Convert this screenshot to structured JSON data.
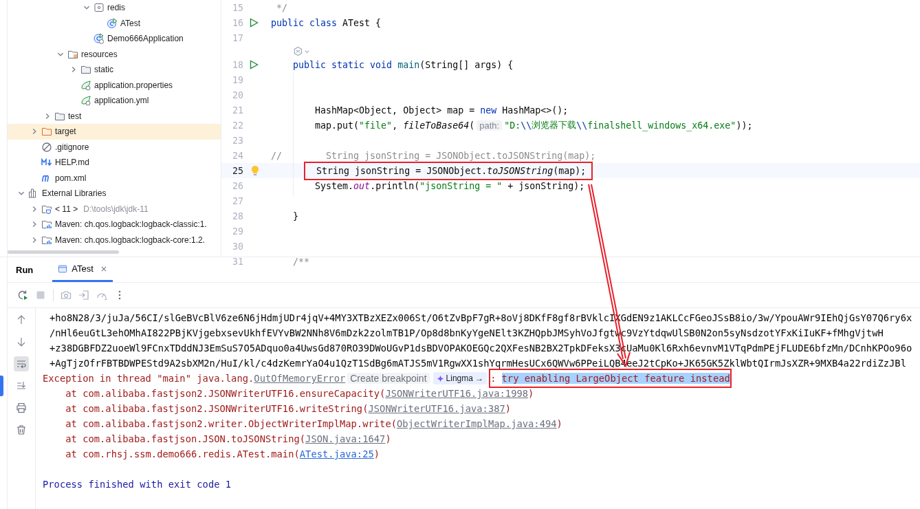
{
  "project_tree": [
    {
      "children": [
        {
          "children": [
            {
              "children": [
                {
                  "children": [
                    {
                      "children": [
                        {
                          "label": "redis",
                          "kind": "package",
                          "expanded": true,
                          "selected": false,
                          "children": [
                            {
                              "label": "ATest",
                              "kind": "class",
                              "selected": false
                            }
                          ]
                        },
                        {
                          "label": "Demo666Application",
                          "kind": "spring-class",
                          "selected": false
                        }
                      ]
                    }
                  ]
                },
                {
                  "label": "resources",
                  "kind": "resources-folder",
                  "expanded": true,
                  "selected": false,
                  "children": [
                    {
                      "label": "static",
                      "kind": "folder",
                      "expanded": false,
                      "selected": false
                    },
                    {
                      "label": "application.properties",
                      "kind": "spring-config",
                      "selected": false
                    },
                    {
                      "label": "application.yml",
                      "kind": "spring-config",
                      "selected": false
                    }
                  ]
                }
              ]
            },
            {
              "label": "test",
              "kind": "folder",
              "expanded": false,
              "selected": false
            }
          ]
        },
        {
          "label": "target",
          "kind": "excluded-folder",
          "expanded": false,
          "selected": true
        },
        {
          "label": ".gitignore",
          "kind": "ignore",
          "selected": false
        },
        {
          "label": "HELP.md",
          "kind": "markdown",
          "selected": false
        },
        {
          "label": "pom.xml",
          "kind": "maven",
          "selected": false
        }
      ]
    },
    {
      "label": "External Libraries",
      "kind": "libraries",
      "expanded": true,
      "selected": false,
      "children": [
        {
          "label": "< 11 >",
          "detail": "D:\\tools\\jdk\\jdk-11",
          "kind": "jdk",
          "expanded": false,
          "selected": false
        },
        {
          "label": "Maven: ch.qos.logback:logback-classic:1.",
          "kind": "library",
          "expanded": false,
          "selected": false
        },
        {
          "label": "Maven: ch.qos.logback:logback-core:1.2.",
          "kind": "library",
          "expanded": false,
          "selected": false
        }
      ]
    }
  ],
  "editor": {
    "lines": [
      {
        "kind": "code",
        "number": "15",
        "current": false,
        "tokens": [
          {
            "text": " */",
            "kind": "comment"
          }
        ]
      },
      {
        "kind": "code",
        "number": "16",
        "current": false,
        "marker": {
          "kind": "run"
        },
        "tokens": [
          {
            "text": "public class ",
            "kind": "keyword"
          },
          {
            "text": "ATest {",
            "kind": "plain"
          }
        ]
      },
      {
        "kind": "code",
        "number": "17",
        "current": false
      },
      {
        "kind": "inlay"
      },
      {
        "kind": "code",
        "number": "18",
        "current": false,
        "marker": {
          "kind": "run"
        },
        "tokens": [
          {
            "text": "    public static void ",
            "kind": "keyword"
          },
          {
            "text": "main",
            "kind": "declaration"
          },
          {
            "text": "(String[] args) {",
            "kind": "plain"
          }
        ]
      },
      {
        "kind": "code",
        "number": "19",
        "current": false
      },
      {
        "kind": "code",
        "number": "20",
        "current": false
      },
      {
        "kind": "code",
        "number": "21",
        "current": false,
        "tokens": [
          {
            "text": "        HashMap<Object, Object> map = ",
            "kind": "plain"
          },
          {
            "text": "new",
            "kind": "keyword"
          },
          {
            "text": " HashMap<>();",
            "kind": "plain"
          }
        ]
      },
      {
        "kind": "code",
        "number": "22",
        "current": false,
        "tokens": [
          {
            "text": "        map.put(",
            "kind": "plain"
          },
          {
            "text": "\"file\"",
            "kind": "string"
          },
          {
            "text": ", ",
            "kind": "plain"
          },
          {
            "text": "fileToBase64",
            "kind": "italic"
          },
          {
            "text": "(",
            "kind": "plain"
          },
          {
            "text": "path:",
            "kind": "hint"
          },
          {
            "text": "\"D:",
            "kind": "string"
          },
          {
            "text": "\\\\",
            "kind": "escape"
          },
          {
            "text": "浏览器下载",
            "kind": "string"
          },
          {
            "text": "\\\\",
            "kind": "escape"
          },
          {
            "text": "finalshell_windows_x64.exe\"",
            "kind": "string"
          },
          {
            "text": "));",
            "kind": "plain"
          }
        ]
      },
      {
        "kind": "code",
        "number": "23",
        "current": false
      },
      {
        "kind": "code",
        "number": "24",
        "current": false,
        "tokens": [
          {
            "text": "//        String jsonString = JSONObject.toJSONString(map);",
            "kind": "comment"
          }
        ]
      },
      {
        "kind": "code",
        "number": "25",
        "current": true,
        "marker": {
          "kind": "bulb"
        },
        "tokens": [
          {
            "text": "  String jsonString = JSONObject.",
            "kind": "plain",
            "boxed": true
          },
          {
            "text": "toJSONString",
            "kind": "italic",
            "boxed": true
          },
          {
            "text": "(map); ",
            "kind": "plain",
            "boxed": true
          }
        ]
      },
      {
        "kind": "code",
        "number": "26",
        "current": false,
        "tokens": [
          {
            "text": "        System.",
            "kind": "plain"
          },
          {
            "text": "out",
            "kind": "static-field"
          },
          {
            "text": ".println(",
            "kind": "plain"
          },
          {
            "text": "\"jsonString = \"",
            "kind": "string"
          },
          {
            "text": " + jsonString);",
            "kind": "plain"
          }
        ]
      },
      {
        "kind": "code",
        "number": "27",
        "current": false
      },
      {
        "kind": "code",
        "number": "28",
        "current": false,
        "tokens": [
          {
            "text": "    }",
            "kind": "plain"
          }
        ]
      },
      {
        "kind": "code",
        "number": "29",
        "current": false
      },
      {
        "kind": "code",
        "number": "30",
        "current": false
      },
      {
        "kind": "code",
        "number": "31",
        "current": false,
        "tokens": [
          {
            "text": "    /**",
            "kind": "comment"
          }
        ]
      }
    ]
  },
  "run_panel": {
    "title": "Run",
    "tabs": [
      {
        "label": "ATest",
        "selected": true
      }
    ],
    "console": [
      {
        "kind": "output",
        "segments": [
          {
            "text": "+ho8N28/3/juJa/56CI/slGeBVcBlV6ze6N6jHdmjUDr4jqV+4MY3XTBzXEZx006St/O6tZvBpF7gR+8oVj8DKfF8gf8rBVklcIXGdEN9z1AKLCcFGeoJSsB8io/3w/YpouAWr9IEhQjGsY07Q6ry6x",
            "kind": "plain"
          }
        ]
      },
      {
        "kind": "output",
        "segments": [
          {
            "text": "/nHl6euGtL3ehOMhAI822PBjKVjgebxsevUkhfEVYvBW2NNh8V6mDzk2zolmTB1P/Op8d8bnKyYgeNElt3KZHQpbJMSyhVoJfgtwc9VzYtdqwUlSB0N2on5syNsdzotYFxKiIuKF+fMhgVjtwH",
            "kind": "plain"
          }
        ]
      },
      {
        "kind": "output",
        "segments": [
          {
            "text": "+z38DGBFDZ2uoeWl9FCnxTDddNJ3EmSuS7O5ADquo0a4UwsGd870RO39DWoUGvP1dsBDVOPAKOEGQc2QXFesNB2BX2TpkDFeksX3cUaMu0Kl6Rxh6evnvM1VTqPdmPEjFLUDE6bfzMn/DCnhKPOo96o",
            "kind": "plain"
          }
        ]
      },
      {
        "kind": "output",
        "segments": [
          {
            "text": "+AgTjzOfrFBTBDWPEStd9A2sbXM2n/HuI/kl/c4dzKemrYaO4u1QzT1SdBg6mATJS5mV1RgwXX1shYqrmHesUCx6QWVw6PPeiLQB4eeJ2tCpKo+JK65GK5ZklWbtQIrmJsXZR+9MXB4a22rdiZzJBl",
            "kind": "plain"
          }
        ]
      },
      {
        "kind": "error",
        "segments": [
          {
            "text": "Exception in thread \"main\" java.lang.",
            "kind": "plain"
          },
          {
            "text": "OutOfMemoryError",
            "kind": "link"
          },
          {
            "text": "Create breakpoint",
            "kind": "hint"
          },
          {
            "text": "Lingma →",
            "kind": "chip"
          },
          {
            "text": ":",
            "kind": "plain",
            "boxed": true
          },
          {
            "text": "try enabling LargeObject feature instead",
            "kind": "selected",
            "boxed": true
          }
        ]
      },
      {
        "kind": "error",
        "segments": [
          {
            "text": "    at com.alibaba.fastjson2.JSONWriterUTF16.ensureCapacity(",
            "kind": "plain"
          },
          {
            "text": "JSONWriterUTF16.java:1998",
            "kind": "link"
          },
          {
            "text": ")",
            "kind": "plain"
          }
        ]
      },
      {
        "kind": "error",
        "segments": [
          {
            "text": "    at com.alibaba.fastjson2.JSONWriterUTF16.writeString(",
            "kind": "plain"
          },
          {
            "text": "JSONWriterUTF16.java:387",
            "kind": "link"
          },
          {
            "text": ")",
            "kind": "plain"
          }
        ]
      },
      {
        "kind": "error",
        "segments": [
          {
            "text": "    at com.alibaba.fastjson2.writer.ObjectWriterImplMap.write(",
            "kind": "plain"
          },
          {
            "text": "ObjectWriterImplMap.java:494",
            "kind": "link"
          },
          {
            "text": ")",
            "kind": "plain"
          }
        ]
      },
      {
        "kind": "error",
        "segments": [
          {
            "text": "    at com.alibaba.fastjson.JSON.toJSONString(",
            "kind": "plain"
          },
          {
            "text": "JSON.java:1647",
            "kind": "link"
          },
          {
            "text": ")",
            "kind": "plain"
          }
        ]
      },
      {
        "kind": "error",
        "segments": [
          {
            "text": "    at com.rhsj.ssm.demo666.redis.ATest.main(",
            "kind": "plain"
          },
          {
            "text": "ATest.java:25",
            "kind": "source-link"
          },
          {
            "text": ")",
            "kind": "plain"
          }
        ]
      },
      {
        "kind": "blank"
      },
      {
        "kind": "exit",
        "segments": [
          {
            "text": "Process finished with exit code 1",
            "kind": "plain"
          }
        ]
      }
    ]
  },
  "annotations": [
    {
      "kind": "arrow"
    }
  ]
}
